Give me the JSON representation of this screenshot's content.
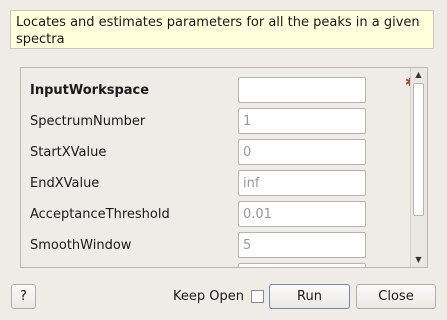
{
  "description": "Locates and estimates parameters for all the peaks in a given spectra",
  "properties": [
    {
      "label": "InputWorkspace",
      "value": "",
      "placeholder": "",
      "required": true
    },
    {
      "label": "SpectrumNumber",
      "value": "",
      "placeholder": "1",
      "required": false
    },
    {
      "label": "StartXValue",
      "value": "",
      "placeholder": "0",
      "required": false
    },
    {
      "label": "EndXValue",
      "value": "",
      "placeholder": "inf",
      "required": false
    },
    {
      "label": "AcceptanceThreshold",
      "value": "",
      "placeholder": "0.01",
      "required": false
    },
    {
      "label": "SmoothWindow",
      "value": "",
      "placeholder": "5",
      "required": false
    }
  ],
  "icons": {
    "required": "red-asterisk-icon",
    "scroll_up": "triangle-up-icon",
    "scroll_down": "triangle-down-icon"
  },
  "colors": {
    "description_bg": "#ffffdc",
    "required_marker": "#c0392b",
    "dialog_bg": "#efebe7"
  },
  "footer": {
    "help_label": "?",
    "keep_open_label": "Keep Open",
    "keep_open_checked": false,
    "run_label": "Run",
    "close_label": "Close"
  }
}
